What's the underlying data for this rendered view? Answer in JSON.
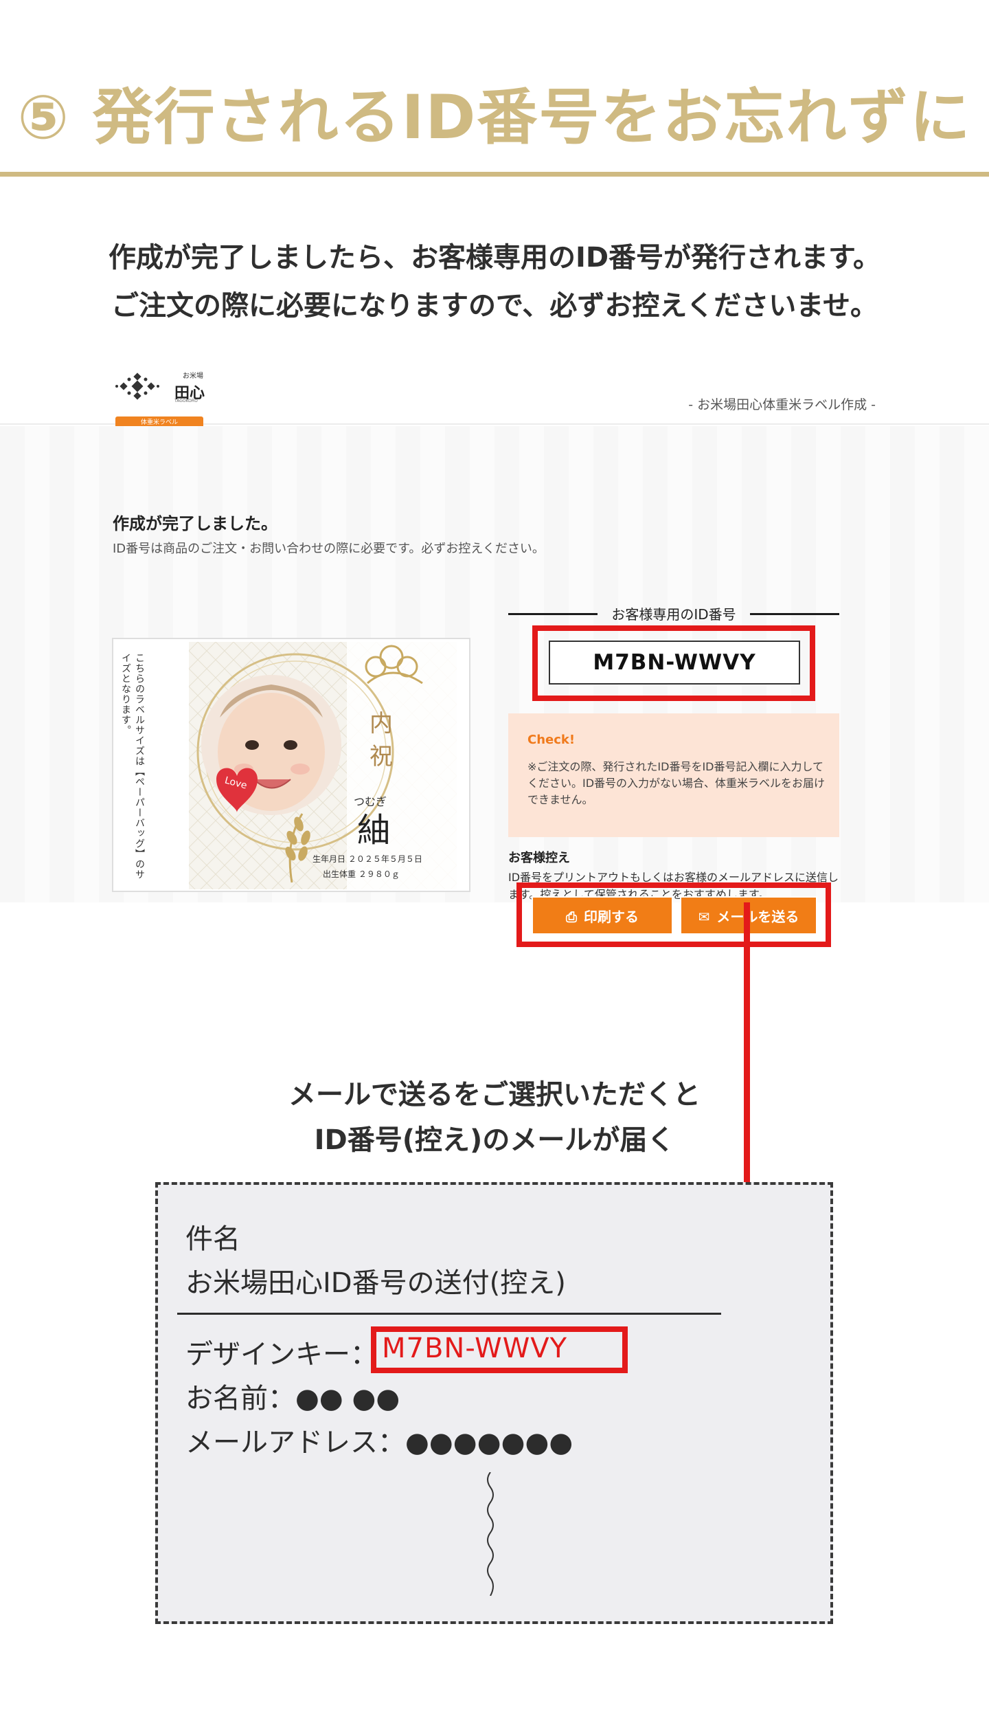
{
  "heading": "⑤ 発行されるID番号をお忘れずに",
  "intro": {
    "line1": "作成が完了しましたら、お客様専用のID番号が発行されます。",
    "line2": "ご注文の際に必要になりますので、必ずお控えくださいませ。"
  },
  "site": {
    "logo_small": "お米場",
    "logo_name": "田心",
    "logo_romaji": "TAGOKORO",
    "logo_badge": "体重米ラベル",
    "subtitle": "- お米場田心体重米ラベル作成 -"
  },
  "complete": {
    "title": "作成が完了しました。",
    "description": "ID番号は商品のご注文・お問い合わせの際に必要です。必ずお控えください。"
  },
  "label_preview": {
    "side_text": "こちらのラベルサイズは【ペーパーバッグ】のサイズとなります。",
    "heading1": "内",
    "heading2": "祝",
    "badge": "Love",
    "name_kana": "つむぎ",
    "name": "紬",
    "birth": "生年月日 ２０２５年５月５日",
    "weight": "出生体重 ２９８０ｇ"
  },
  "id_panel": {
    "caption": "お客様専用のID番号",
    "id_number": "M7BN-WWVY",
    "check_title": "Check!",
    "check_text": "※ご注文の際、発行されたID番号をID番号記入欄に入力してください。ID番号の入力がない場合、体重米ラベルをお届けできません。",
    "hikae_title": "お客様控え",
    "hikae_text": "ID番号をプリントアウトもしくはお客様のメールアドレスに送信します。控えとして保管されることをおすすめします。",
    "print_button": "印刷する",
    "mail_button": "メールを送る"
  },
  "mail_caption": {
    "line1": "メールで送るをご選択いただくと",
    "line2": "ID番号(控え)のメールが届く"
  },
  "email": {
    "subject_label": "件名",
    "subject": "お米場田心ID番号の送付(控え)",
    "key_label": "デザインキー：",
    "key_value": "M7BN-WWVY",
    "name_label": "お名前：",
    "name_value": "●● ●●",
    "address_label": "メールアドレス：",
    "address_value": "●●●●●●●"
  },
  "colors": {
    "gold": "#cfba82",
    "red": "#e31a1a",
    "orange": "#f17d16",
    "check_bg": "#fde4d6"
  }
}
